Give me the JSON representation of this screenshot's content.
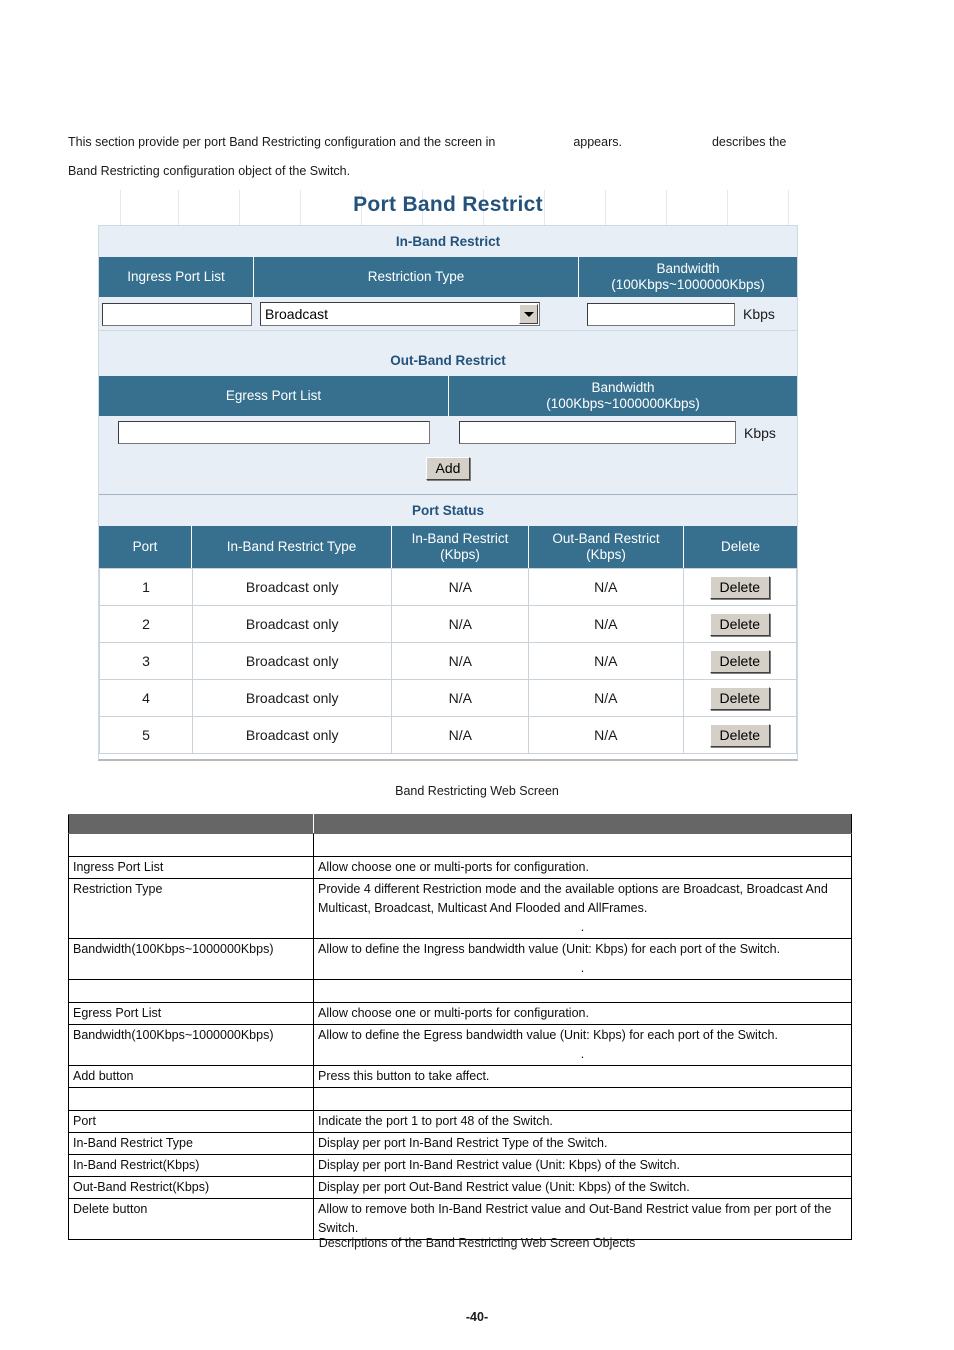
{
  "intro": {
    "line1_a": "This section provide per port Band Restricting configuration and the screen in",
    "line1_b": "appears.",
    "line1_c": "describes the",
    "line2": "Band Restricting configuration object of the Switch."
  },
  "webscreen": {
    "title": "Port Band Restrict",
    "inband": {
      "section_label": "In-Band Restrict",
      "headers": [
        "Ingress Port List",
        "Restriction Type",
        "Bandwidth\n(100Kbps~1000000Kbps)"
      ],
      "header_bandwidth_l1": "Bandwidth",
      "header_bandwidth_l2": "(100Kbps~1000000Kbps)",
      "ingress_port_value": "",
      "ingress_port_placeholder": "",
      "restriction_type_selected": "Broadcast",
      "restriction_type_options": [
        "Broadcast",
        "Broadcast And Multicast",
        "Broadcast, Multicast And Flooded",
        "AllFrames"
      ],
      "bandwidth_value": "",
      "bandwidth_unit": "Kbps"
    },
    "outband": {
      "section_label": "Out-Band Restrict",
      "header_egress": "Egress Port List",
      "header_bandwidth_l1": "Bandwidth",
      "header_bandwidth_l2": "(100Kbps~1000000Kbps)",
      "egress_port_value": "",
      "bandwidth_value": "",
      "bandwidth_unit": "Kbps",
      "add_button": "Add"
    },
    "portstatus": {
      "section_label": "Port Status",
      "columns": [
        "Port",
        "In-Band Restrict Type",
        "In-Band Restrict\n(Kbps)",
        "Out-Band Restrict\n(Kbps)",
        "Delete"
      ],
      "col_port": "Port",
      "col_inband_type": "In-Band Restrict Type",
      "col_inband_l1": "In-Band Restrict",
      "col_inband_l2": "(Kbps)",
      "col_outband_l1": "Out-Band Restrict",
      "col_outband_l2": "(Kbps)",
      "col_delete": "Delete",
      "rows": [
        {
          "port": "1",
          "type": "Broadcast only",
          "inband": "N/A",
          "outband": "N/A",
          "delete": "Delete"
        },
        {
          "port": "2",
          "type": "Broadcast only",
          "inband": "N/A",
          "outband": "N/A",
          "delete": "Delete"
        },
        {
          "port": "3",
          "type": "Broadcast only",
          "inband": "N/A",
          "outband": "N/A",
          "delete": "Delete"
        },
        {
          "port": "4",
          "type": "Broadcast only",
          "inband": "N/A",
          "outband": "N/A",
          "delete": "Delete"
        },
        {
          "port": "5",
          "type": "Broadcast only",
          "inband": "N/A",
          "outband": "N/A",
          "delete": "Delete"
        }
      ]
    }
  },
  "figure_caption": "Band Restricting Web Screen",
  "table_caption": "Descriptions of the Band Restricting Web Screen Objects",
  "descriptions": {
    "header_left": "",
    "header_right": "",
    "rows": [
      {
        "key": "Ingress Port List",
        "value": "Allow choose one or multi-ports for configuration.",
        "dot": ""
      },
      {
        "key": "Restriction Type",
        "value": "Provide 4 different Restriction mode and the available options are Broadcast, Broadcast And Multicast, Broadcast, Multicast And Flooded and AllFrames.",
        "dot": "."
      },
      {
        "key": "Bandwidth(100Kbps~1000000Kbps)",
        "value": "Allow to define the Ingress bandwidth value (Unit: Kbps) for each port of the Switch.",
        "dot": "."
      },
      {
        "key": "Egress Port List",
        "value": "Allow choose one or multi-ports for configuration.",
        "dot": ""
      },
      {
        "key": "Bandwidth(100Kbps~1000000Kbps)",
        "value": "Allow to define the Egress bandwidth value (Unit: Kbps) for each port of the Switch.",
        "dot": "."
      },
      {
        "key": "Add button",
        "value": "Press this button to take affect.",
        "dot": ""
      },
      {
        "key": "Port",
        "value": "Indicate the port 1 to port 48 of the Switch.",
        "dot": ""
      },
      {
        "key": "In-Band Restrict Type",
        "value": "Display per port In-Band Restrict Type of the Switch.",
        "dot": ""
      },
      {
        "key": "In-Band Restrict(Kbps)",
        "value": "Display per port In-Band Restrict value (Unit: Kbps) of the Switch.",
        "dot": ""
      },
      {
        "key": "Out-Band Restrict(Kbps)",
        "value": "Display per port Out-Band Restrict value (Unit: Kbps) of the Switch.",
        "dot": ""
      },
      {
        "key": "Delete button",
        "value": "Allow to remove both In-Band Restrict value and Out-Band Restrict value from per port of the Switch.",
        "dot": ""
      }
    ]
  },
  "page_number": "-40-",
  "colors": {
    "header_blue": "#37708f",
    "panel_light": "#e8eef5",
    "title_blue": "#23527c",
    "desc_header_gray": "#666666",
    "button_face": "#d4d0c8"
  }
}
